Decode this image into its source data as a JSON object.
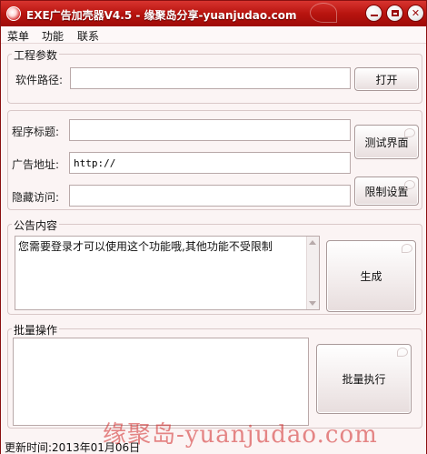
{
  "window": {
    "title": "EXE广告加壳器V4.5 - 缘聚岛分享-yuanjudao.com",
    "controls": {
      "minimize": "minimize-icon",
      "maximize": "maximize-icon",
      "close": "close-icon"
    }
  },
  "menu": {
    "items": [
      "菜单",
      "功能",
      "联系"
    ]
  },
  "project": {
    "legend": "工程参数",
    "path_label": "软件路径:",
    "path_value": "",
    "open_button": "打开"
  },
  "info": {
    "title_label": "程序标题:",
    "title_value": "",
    "ad_label": "广告地址:",
    "ad_value": "http://",
    "hidden_label": "隐藏访问:",
    "hidden_value": "",
    "test_button": "测试界面",
    "limit_button": "限制设置"
  },
  "notice": {
    "legend": "公告内容",
    "text": "您需要登录才可以使用这个功能哦,其他功能不受限制",
    "generate_button": "生成"
  },
  "batch": {
    "legend": "批量操作",
    "text": "",
    "run_button": "批量执行"
  },
  "status": {
    "text": "更新时间:2013年01月06日"
  },
  "watermark": {
    "text": "缘聚岛-yuanjudao.com"
  },
  "colors": {
    "titlebar": "#b8140f",
    "window_bg": "#fbf4f4",
    "border": "#d9c8c8",
    "watermark": "#d22828"
  }
}
